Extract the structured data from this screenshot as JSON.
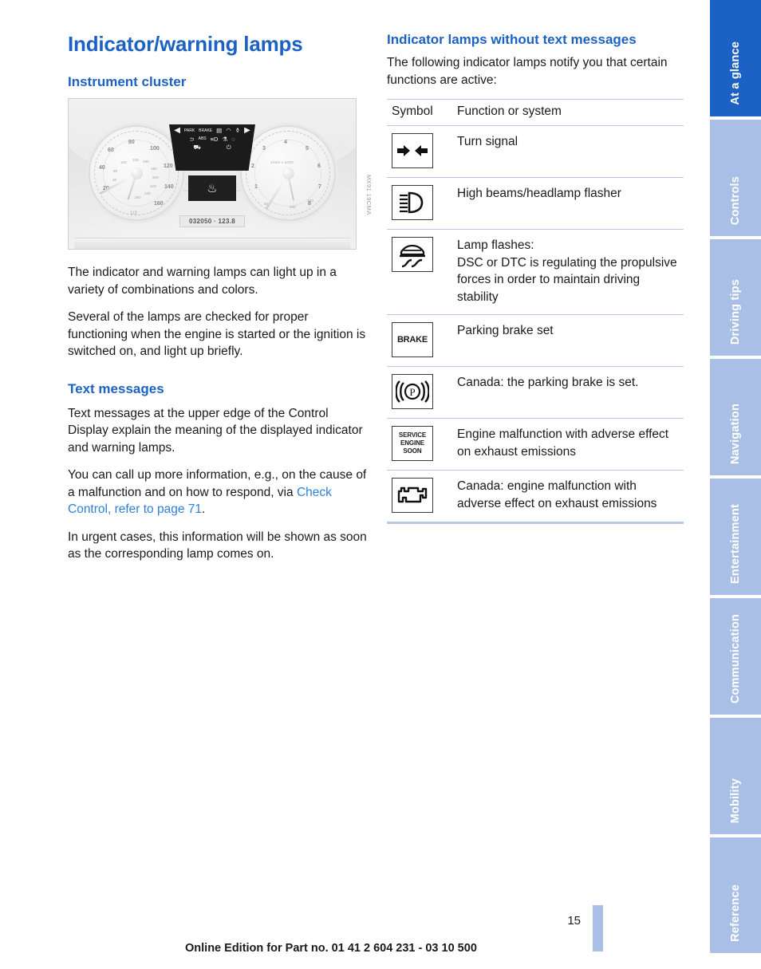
{
  "document": {
    "title": "Indicator/warning lamps",
    "page_number": "15",
    "footer": "Online Edition for Part no. 01 41 2 604 231 - 03 10 500"
  },
  "colors": {
    "accent": "#1c62c4",
    "tab_inactive": "#a9bfe6",
    "rule": "#b9c9e4",
    "link": "#2f7fd8"
  },
  "left_column": {
    "section_instrument_cluster": {
      "heading": "Instrument cluster",
      "figure_caption": "MX91 19CMA",
      "cluster": {
        "odometer": "032050 · 123.8",
        "speed_numbers": [
          "20",
          "40",
          "60",
          "80",
          "100",
          "120",
          "140",
          "160"
        ],
        "speed_inner_numbers": [
          "20",
          "40",
          "60",
          "80",
          "100",
          "120",
          "160",
          "180",
          "200",
          "220",
          "240",
          "260"
        ],
        "rpm_numbers": [
          "1",
          "2",
          "3",
          "4",
          "5",
          "6",
          "7",
          "8"
        ],
        "rpm_caption": "1/min x 1000",
        "fuel_label": "1/2",
        "temp_numbers": [
          "50",
          "250",
          "240"
        ],
        "lamp_row_1": [
          "PARK",
          "BRAKE"
        ],
        "lamp_row_2": [
          "ABS"
        ]
      },
      "paragraphs": [
        "The indicator and warning lamps can light up in a variety of combinations and colors.",
        "Several of the lamps are checked for proper functioning when the engine is started or the ignition is switched on, and light up briefly."
      ]
    },
    "section_text_messages": {
      "heading": "Text messages",
      "paragraph_1": "Text messages at the upper edge of the Control Display explain the meaning of the displayed indicator and warning lamps.",
      "paragraph_2_prefix": "You can call up more information, e.g., on the cause of a malfunction and on how to respond, via ",
      "paragraph_2_link": "Check Control, refer to page 71",
      "paragraph_2_suffix": ".",
      "paragraph_3": "In urgent cases, this information will be shown as soon as the corresponding lamp comes on."
    }
  },
  "right_column": {
    "heading": "Indicator lamps without text messages",
    "intro": "The following indicator lamps notify you that certain functions are active:",
    "table": {
      "headers": [
        "Symbol",
        "Function or system"
      ],
      "rows": [
        {
          "symbol_name": "turn-signal-icon",
          "symbol_text": "",
          "function": "Turn signal",
          "function_extra": ""
        },
        {
          "symbol_name": "high-beam-icon",
          "symbol_text": "",
          "function": "High beams/headlamp flasher",
          "function_extra": ""
        },
        {
          "symbol_name": "dsc-skid-icon",
          "symbol_text": "",
          "function": "Lamp flashes:",
          "function_extra": "DSC or DTC is regulating the propulsive forces in order to maintain driving stability"
        },
        {
          "symbol_name": "brake-text-icon",
          "symbol_text": "BRAKE",
          "function": "Parking brake set",
          "function_extra": ""
        },
        {
          "symbol_name": "parking-brake-canada-icon",
          "symbol_text": "",
          "function": "Canada: the parking brake is set.",
          "function_extra": ""
        },
        {
          "symbol_name": "service-engine-soon-icon",
          "symbol_text": "SERVICE ENGINE SOON",
          "function": "Engine malfunction with adverse effect on exhaust emissions",
          "function_extra": ""
        },
        {
          "symbol_name": "check-engine-icon",
          "symbol_text": "",
          "function": "Canada: engine malfunction with adverse effect on exhaust emissions",
          "function_extra": ""
        }
      ]
    }
  },
  "sidebar": {
    "tabs": [
      {
        "label": "At a glance",
        "active": true
      },
      {
        "label": "Controls",
        "active": false
      },
      {
        "label": "Driving tips",
        "active": false
      },
      {
        "label": "Navigation",
        "active": false
      },
      {
        "label": "Entertainment",
        "active": false
      },
      {
        "label": "Communication",
        "active": false
      },
      {
        "label": "Mobility",
        "active": false
      },
      {
        "label": "Reference",
        "active": false
      }
    ]
  }
}
